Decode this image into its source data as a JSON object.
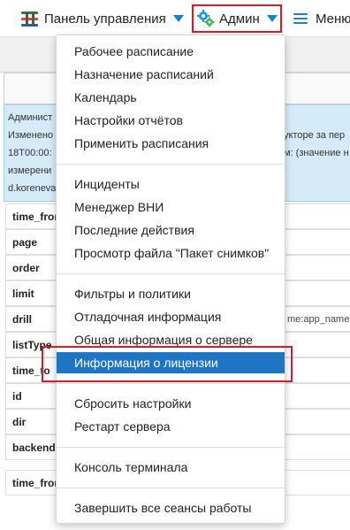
{
  "topbar": {
    "panel_label": "Панель управления",
    "admin_label": "Админ",
    "menu_label": "Меню"
  },
  "info": {
    "line1": "Админист",
    "line2": "Изменено",
    "line2_right": "укторе за пер",
    "line3": "18T00:00:",
    "line3_right": "м: (значение н",
    "line4": "измерени",
    "line5": "d.koreneva"
  },
  "table": {
    "rows": [
      {
        "key": "time_from",
        "value": ""
      },
      {
        "key": "page",
        "value": ""
      },
      {
        "key": "order",
        "value": ""
      },
      {
        "key": "limit",
        "value": ""
      },
      {
        "key": "drill",
        "value": "me:app_name"
      },
      {
        "key": "listType",
        "value": ""
      },
      {
        "key": "time_to",
        "value": ""
      },
      {
        "key": "id",
        "value": ""
      },
      {
        "key": "dir",
        "value": ""
      },
      {
        "key": "backend",
        "value": ""
      }
    ],
    "second_row_key": "time_from"
  },
  "dropdown": {
    "groups": [
      [
        "Рабочее расписание",
        "Назначение расписаний",
        "Календарь",
        "Настройки отчётов",
        "Применить расписания"
      ],
      [
        "Инциденты",
        "Менеджер ВНИ",
        "Последние действия",
        "Просмотр файла \"Пакет снимков\""
      ],
      [
        "Фильтры и политики",
        "Отладочная информация",
        "Общая информация о сервере",
        "Информация о лицензии"
      ],
      [
        "Сбросить настройки",
        "Рестарт сервера"
      ],
      [
        "Консоль терминала"
      ],
      [
        "Завершить все сеансы работы"
      ]
    ],
    "active_item": "Информация о лицензии"
  },
  "colors": {
    "accent": "#1c7fd0",
    "active_bg": "#1f74c4",
    "highlight": "#d81b2a",
    "info_bg": "#d5ebf8"
  }
}
